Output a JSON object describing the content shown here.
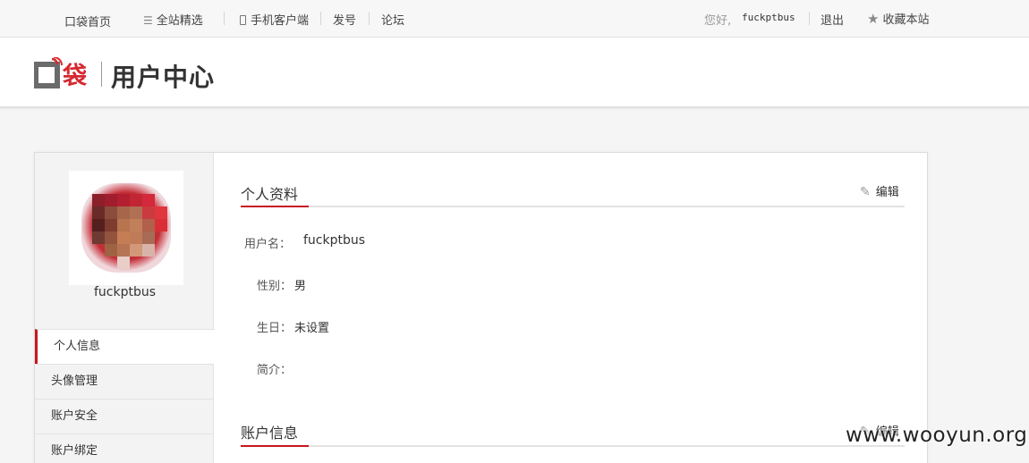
{
  "topnav": {
    "home": "口袋首页",
    "sites": "全站精选",
    "mobile": "手机客户端",
    "fahao": "发号",
    "forum": "论坛",
    "greeting": "您好,",
    "username": "fuckptbus",
    "logout": "退出",
    "favorite": "收藏本站"
  },
  "header": {
    "logo_text": "口袋",
    "center_title": "用户中心"
  },
  "sidebar": {
    "username": "fuckptbus",
    "menu": [
      {
        "label": "个人信息",
        "active": true
      },
      {
        "label": "头像管理",
        "active": false
      },
      {
        "label": "账户安全",
        "active": false
      },
      {
        "label": "账户绑定",
        "active": false
      }
    ]
  },
  "profile": {
    "title": "个人资料",
    "edit": "编辑",
    "username_label": "用户名：",
    "username_value": "fuckptbus",
    "gender_label": "性别：",
    "gender_value": "男",
    "birthday_label": "生日：",
    "birthday_value": "未设置",
    "bio_label": "简介：",
    "bio_value": ""
  },
  "account": {
    "title": "账户信息",
    "edit": "编辑"
  },
  "watermark": "www.wooyun.org",
  "colors": {
    "accent": "#c8161d",
    "logo_red": "#d7282f",
    "logo_gray": "#6b6b6b"
  }
}
